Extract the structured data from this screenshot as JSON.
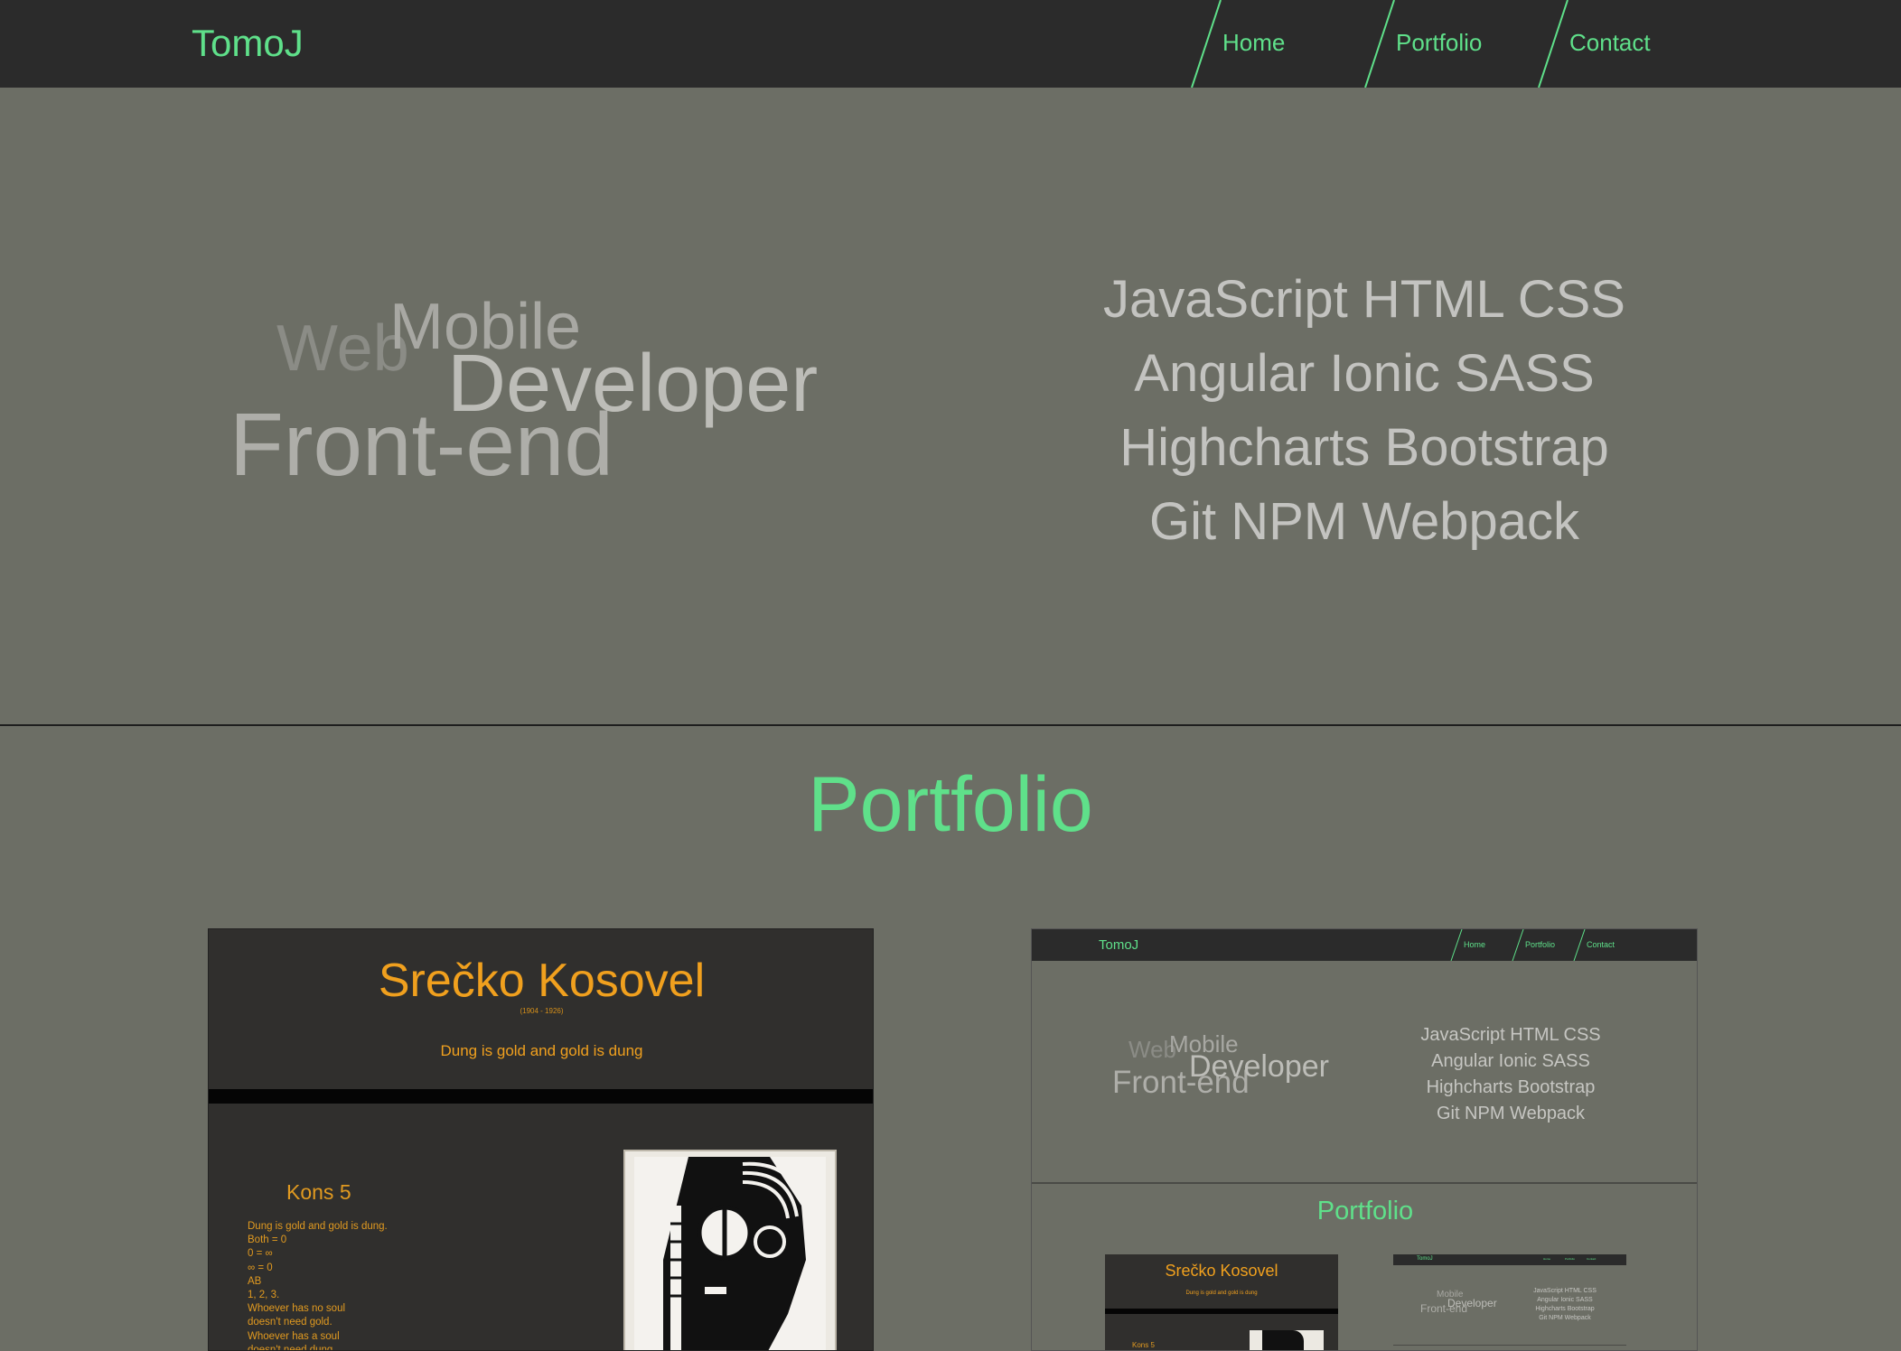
{
  "nav": {
    "brand": "TomoJ",
    "items": [
      {
        "label": "Home"
      },
      {
        "label": "Portfolio"
      },
      {
        "label": "Contact"
      }
    ]
  },
  "hero": {
    "words": {
      "web": "Web",
      "mobile": "Mobile",
      "developer": "Developer",
      "frontend": "Front-end"
    },
    "skills": [
      "JavaScript HTML CSS",
      "Angular Ionic SASS",
      "Highcharts Bootstrap",
      "Git NPM Webpack"
    ]
  },
  "portfolio": {
    "title": "Portfolio",
    "card1": {
      "title": "Srečko Kosovel",
      "years": "(1904 - 1926)",
      "quote": "Dung is gold and gold is dung",
      "poem_title": "Kons 5",
      "poem_lines": [
        "Dung is gold and gold is dung.",
        "Both = 0",
        "0 = ∞",
        "∞ = 0",
        "AB",
        "1, 2, 3.",
        "Whoever has no soul",
        "doesn't need gold.",
        "Whoever has a soul",
        "doesn't need dung."
      ]
    },
    "card2": {
      "brand": "TomoJ",
      "nav": [
        "Home",
        "Portfolio",
        "Contact"
      ],
      "words": {
        "web": "Web",
        "mobile": "Mobile",
        "developer": "Developer",
        "frontend": "Front-end"
      },
      "skills": [
        "JavaScript HTML CSS",
        "Angular Ionic SASS",
        "Highcharts Bootstrap",
        "Git NPM Webpack"
      ],
      "title": "Portfolio",
      "sub1": {
        "title": "Srečko Kosovel",
        "quote": "Dung is gold and gold is dung",
        "poem_title": "Kons 5"
      },
      "sub2": {
        "brand": "TomoJ",
        "nav": [
          "Home",
          "Portfolio",
          "Contact"
        ],
        "words": {
          "mobile": "Mobile",
          "developer": "Developer",
          "frontend": "Front-end"
        },
        "skills": [
          "JavaScript HTML CSS",
          "Angular Ionic SASS",
          "Highcharts Bootstrap",
          "Git NPM Webpack"
        ]
      }
    }
  },
  "colors": {
    "accent": "#5fe08a",
    "background": "#6c6e65",
    "navbar": "#2b2b2b",
    "card_orange": "#f0a01e"
  }
}
